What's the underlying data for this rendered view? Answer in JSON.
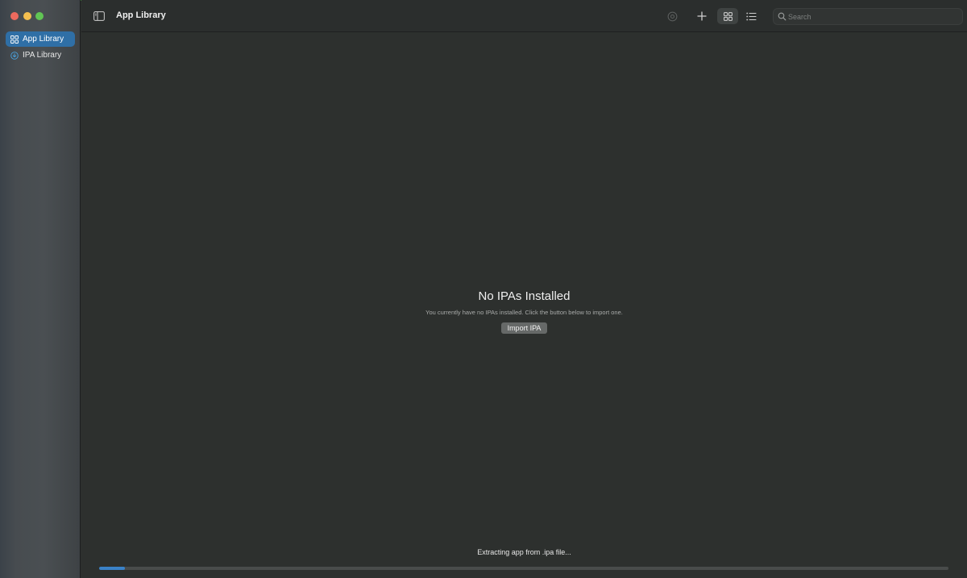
{
  "window": {
    "title": "App Library"
  },
  "sidebar": {
    "items": [
      {
        "label": "App Library",
        "icon": "grid-icon",
        "selected": true
      },
      {
        "label": "IPA Library",
        "icon": "download-circle-icon",
        "selected": false
      }
    ]
  },
  "toolbar": {
    "title": "App Library",
    "search_placeholder": "Search",
    "buttons": [
      {
        "icon": "gear-icon",
        "enabled": false
      },
      {
        "icon": "plus-icon",
        "enabled": true
      },
      {
        "icon": "grid-view-icon",
        "active": true
      },
      {
        "icon": "list-view-icon",
        "active": false
      }
    ]
  },
  "main": {
    "empty_title": "No IPAs Installed",
    "empty_message": "You currently have no IPAs installed. Click the button below to import one.",
    "import_button": "Import IPA"
  },
  "status": {
    "text": "Extracting app from .ipa file...",
    "progress": 0.03
  },
  "colors": {
    "accent": "#2f6fa6",
    "progress": "#3a82c8",
    "background": "#2d302e",
    "traffic_close": "#ed6a5e",
    "traffic_minimize": "#f4bf4f",
    "traffic_maximize": "#61c554"
  }
}
